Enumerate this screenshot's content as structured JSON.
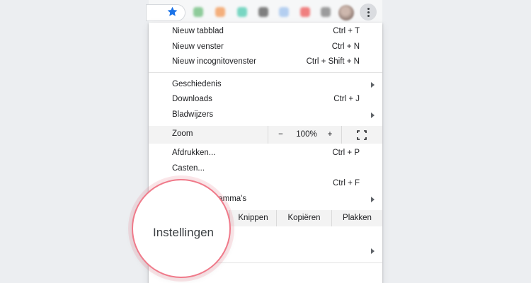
{
  "toolbar": {
    "extension_colors": [
      "#7cc48a",
      "#f4a367",
      "#63d1b9",
      "#6b6b6b",
      "#a9c8ef",
      "#ef6b6b",
      "#8c8c8c"
    ],
    "star_icon": "star-icon",
    "menu_icon": "three-dots-vertical-icon"
  },
  "menu": {
    "new_tab": {
      "label": "Nieuw tabblad",
      "shortcut": "Ctrl + T"
    },
    "new_window": {
      "label": "Nieuw venster",
      "shortcut": "Ctrl + N"
    },
    "new_incognito": {
      "label": "Nieuw incognitovenster",
      "shortcut": "Ctrl + Shift + N"
    },
    "history": {
      "label": "Geschiedenis"
    },
    "downloads": {
      "label": "Downloads",
      "shortcut": "Ctrl + J"
    },
    "bookmarks": {
      "label": "Bladwijzers"
    },
    "zoom": {
      "label": "Zoom",
      "minus": "−",
      "value": "100%",
      "plus": "+"
    },
    "print": {
      "label": "Afdrukken...",
      "shortcut": "Ctrl + P"
    },
    "cast": {
      "label": "Casten..."
    },
    "find": {
      "shortcut": "Ctrl + F"
    },
    "more_tools": {
      "label": "gramma's"
    },
    "edit": {
      "cut": "Knippen",
      "copy": "Kopiëren",
      "paste": "Plakken"
    }
  },
  "magnifier": {
    "label": "Instellingen"
  },
  "colors": {
    "accent": "#f07a8a",
    "star": "#1a73e8"
  }
}
